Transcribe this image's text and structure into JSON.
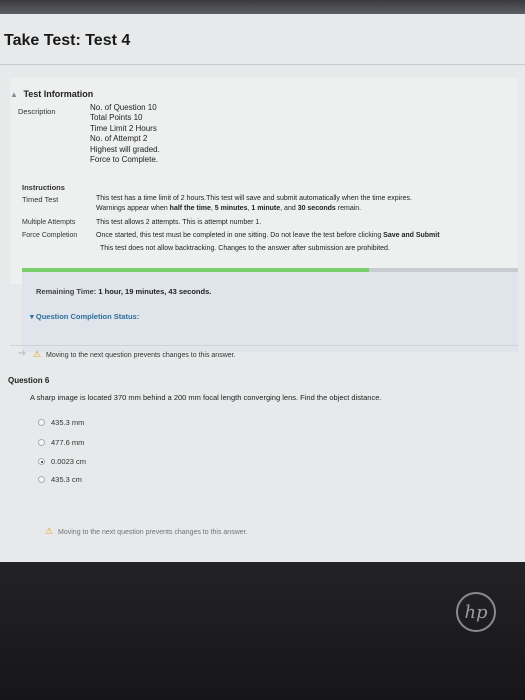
{
  "page": {
    "title": "Take Test: Test 4"
  },
  "info": {
    "heading": "Test Information",
    "description_label": "Description",
    "description_lines": [
      "No. of Question 10",
      "Total Points 10",
      "Time Limit 2 Hours",
      "No. of Attempt 2",
      "Highest will graded.",
      "Force to Complete."
    ],
    "instructions_label": "Instructions",
    "timed_label": "Timed Test",
    "timed_line1": "This test has a time limit of 2 hours.This test will save and submit automatically when the time expires.",
    "timed_line2_pre": "Warnings appear when ",
    "timed_line2_half": "half the time",
    "timed_line2_sep1": ", ",
    "timed_line2_5min": "5 minutes",
    "timed_line2_sep2": ", ",
    "timed_line2_1min": "1 minute",
    "timed_line2_and": ", and ",
    "timed_line2_30sec": "30 seconds",
    "timed_line2_post": " remain.",
    "multiple_label": "Multiple Attempts",
    "multiple_text": "This test allows 2 attempts. This is attempt number 1.",
    "force_label": "Force Completion",
    "force_text_pre": "Once started, this test must be completed in one sitting. Do not leave the test before clicking ",
    "force_text_bold": "Save and Submit",
    "force_text2": "This test does not allow backtracking. Changes to the answer after submission are prohibited."
  },
  "progress": {
    "fraction": 0.7
  },
  "remaining": {
    "label": "Remaining Time:",
    "value": "1 hour, 19 minutes, 43 seconds."
  },
  "status": {
    "label": "Question Completion Status:"
  },
  "warning": {
    "text": "Moving to the next question prevents changes to this answer."
  },
  "question": {
    "label": "Question 6",
    "text": "A sharp image is located 370 mm behind a 200 mm focal length converging lens. Find the object distance.",
    "options": [
      {
        "text": "435.3 mm",
        "selected": false
      },
      {
        "text": "477.6 mm",
        "selected": false
      },
      {
        "text": "0.0023 cm",
        "selected": true
      },
      {
        "text": "435.3 cm",
        "selected": false
      }
    ]
  },
  "colors": {
    "progress": "#7bcf6b",
    "status_link": "#2f6f9f",
    "warning_icon": "#e6a21a"
  },
  "icons": {
    "warning": "warning-triangle-icon",
    "logo": "hp-logo"
  }
}
